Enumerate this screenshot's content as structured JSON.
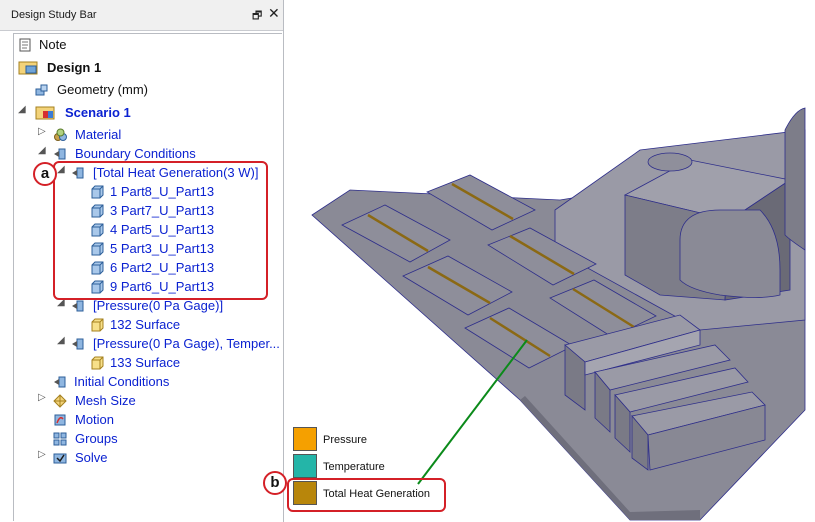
{
  "panel": {
    "title": "Design Study Bar",
    "pin_glyph": "🗗",
    "close_glyph": "✕"
  },
  "tree": {
    "note": "Note",
    "design": "Design 1",
    "geometry": "Geometry (mm)",
    "scenario": "Scenario 1",
    "material": "Material",
    "boundary": "Boundary Conditions",
    "total_heat": "[Total Heat Generation(3 W)]",
    "parts": [
      "1 Part8_U_Part13",
      "3 Part7_U_Part13",
      "4 Part5_U_Part13",
      "5 Part3_U_Part13",
      "6 Part2_U_Part13",
      "9 Part6_U_Part13"
    ],
    "pressure": "[Pressure(0 Pa Gage)]",
    "surface132": "132 Surface",
    "pressure_temp": "[Pressure(0 Pa Gage), Temper...",
    "surface133": "133 Surface",
    "initial": "Initial Conditions",
    "mesh": "Mesh Size",
    "motion": "Motion",
    "groups": "Groups",
    "solve": "Solve"
  },
  "callouts": {
    "a": "a",
    "b": "b"
  },
  "legend": [
    {
      "label": "Pressure",
      "color": "#f5a000"
    },
    {
      "label": "Temperature",
      "color": "#24b5a8"
    },
    {
      "label": "Total Heat Generation",
      "color": "#b8860b"
    }
  ],
  "colors": {
    "accent_red": "#d42027",
    "tree_blue": "#0b22d1",
    "leader_green": "#0b8a1a",
    "model_gray": "#8a8a96"
  }
}
